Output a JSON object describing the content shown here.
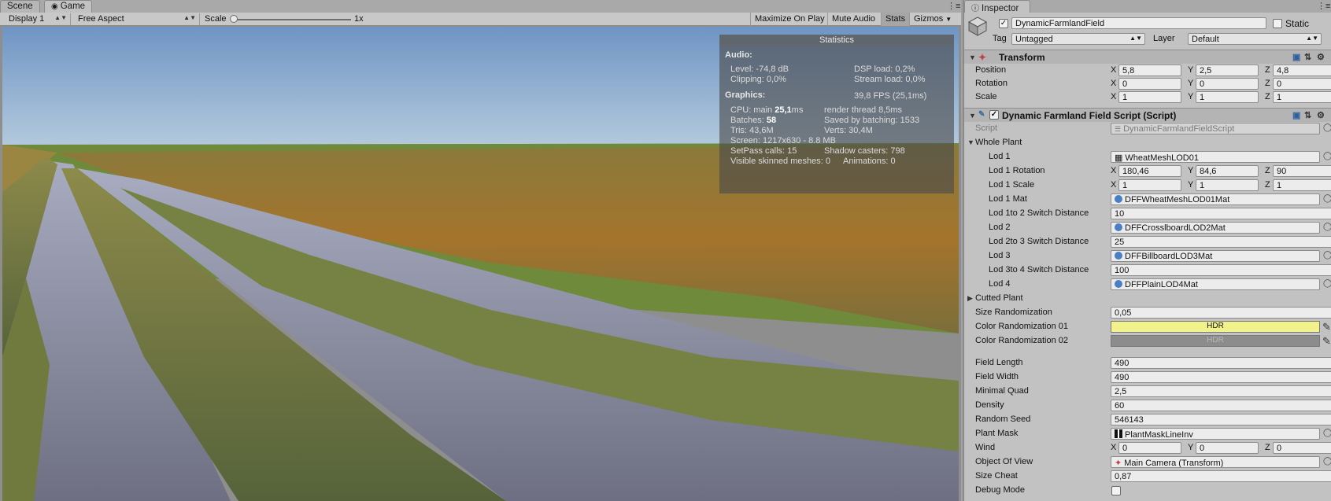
{
  "tabs": {
    "scene": "Scene",
    "game": "Game",
    "inspector": "Inspector"
  },
  "game_toolbar": {
    "display": "Display 1",
    "aspect": "Free Aspect",
    "scale_label": "Scale",
    "scale_value": "1x",
    "scale_fraction": 0.0,
    "maximize": "Maximize On Play",
    "mute": "Mute Audio",
    "stats": "Stats",
    "gizmos": "Gizmos"
  },
  "stats": {
    "title": "Statistics",
    "audio_heading": "Audio:",
    "level": "Level: -74,8 dB",
    "dsp": "DSP load: 0,2%",
    "clipping": "Clipping: 0,0%",
    "stream": "Stream load: 0,0%",
    "graphics_heading": "Graphics:",
    "fps": "39,8 FPS (25,1ms)",
    "cpu_prefix": "CPU: main ",
    "cpu_main": "25,1",
    "cpu_suffix": "ms",
    "render_thread": "render thread 8,5ms",
    "batches_prefix": "Batches: ",
    "batches": "58",
    "saved_batching": "Saved by batching: 1533",
    "tris": "Tris: 43,6M",
    "verts": "Verts: 30,4M",
    "screen": "Screen: 1217x630 - 8.8 MB",
    "setpass": "SetPass calls: 15",
    "shadow_casters": "Shadow casters: 798",
    "skinned": "Visible skinned meshes: 0",
    "animations": "Animations: 0"
  },
  "inspector": {
    "object_name": "DynamicFarmlandField",
    "static_label": "Static",
    "tag_label": "Tag",
    "tag_value": "Untagged",
    "layer_label": "Layer",
    "layer_value": "Default",
    "transform": {
      "title": "Transform",
      "position_label": "Position",
      "position": {
        "x": "5,8",
        "y": "2,5",
        "z": "4,8"
      },
      "rotation_label": "Rotation",
      "rotation": {
        "x": "0",
        "y": "0",
        "z": "0"
      },
      "scale_label": "Scale",
      "scale": {
        "x": "1",
        "y": "1",
        "z": "1"
      }
    },
    "script_component": {
      "title": "Dynamic Farmland Field Script (Script)",
      "script_label": "Script",
      "script_value": "DynamicFarmlandFieldScript",
      "whole_plant": "Whole Plant",
      "lod1_label": "Lod 1",
      "lod1_value": "WheatMeshLOD01",
      "lod1_rotation_label": "Lod 1 Rotation",
      "lod1_rotation": {
        "x": "180,46",
        "y": "84,6",
        "z": "90"
      },
      "lod1_scale_label": "Lod 1 Scale",
      "lod1_scale": {
        "x": "1",
        "y": "1",
        "z": "1"
      },
      "lod1_mat_label": "Lod 1 Mat",
      "lod1_mat_value": "DFFWheatMeshLOD01Mat",
      "lod1to2_label": "Lod 1to 2 Switch Distance",
      "lod1to2_value": "10",
      "lod2_label": "Lod 2",
      "lod2_value": "DFFCrosslboardLOD2Mat",
      "lod2to3_label": "Lod 2to 3 Switch Distance",
      "lod2to3_value": "25",
      "lod3_label": "Lod 3",
      "lod3_value": "DFFBillboardLOD3Mat",
      "lod3to4_label": "Lod 3to 4 Switch Distance",
      "lod3to4_value": "100",
      "lod4_label": "Lod 4",
      "lod4_value": "DFFPlainLOD4Mat",
      "cutted_plant": "Cutted Plant",
      "size_rand_label": "Size Randomization",
      "size_rand_value": "0,05",
      "color_rand1_label": "Color Randomization 01",
      "color_rand1_hdr": "HDR",
      "color_rand1_color": "#f2f28c",
      "color_rand2_label": "Color Randomization 02",
      "color_rand2_hdr": "HDR",
      "color_rand2_color": "#8c8c8c",
      "field_length_label": "Field Length",
      "field_length_value": "490",
      "field_width_label": "Field Width",
      "field_width_value": "490",
      "minimal_quad_label": "Minimal Quad",
      "minimal_quad_value": "2,5",
      "density_label": "Density",
      "density_value": "60",
      "random_seed_label": "Random Seed",
      "random_seed_value": "546143",
      "plant_mask_label": "Plant Mask",
      "plant_mask_value": "PlantMaskLineInv",
      "wind_label": "Wind",
      "wind": {
        "x": "0",
        "y": "0",
        "z": "0"
      },
      "object_of_view_label": "Object Of View",
      "object_of_view_value": "Main Camera (Transform)",
      "size_cheat_label": "Size Cheat",
      "size_cheat_value": "0,87",
      "debug_mode_label": "Debug Mode",
      "debug_mode_checked": false
    },
    "axis": {
      "x": "X",
      "y": "Y",
      "z": "Z"
    }
  }
}
